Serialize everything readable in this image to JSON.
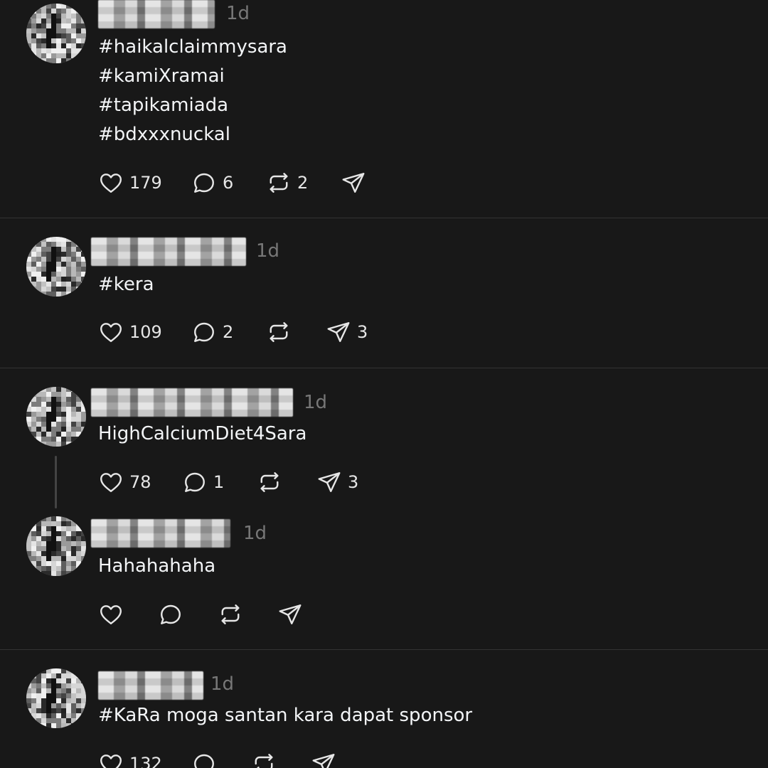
{
  "posts": [
    {
      "timestamp": "1d",
      "text": "#haikalclaimmysara\n#kamiXramai\n#tapikamiada\n#bdxxxnuckal",
      "likes": "179",
      "replies": "6",
      "reposts": "2",
      "shares": ""
    },
    {
      "timestamp": "1d",
      "text": "#kera",
      "likes": "109",
      "replies": "2",
      "reposts": "",
      "shares": "3"
    },
    {
      "timestamp": "1d",
      "text": "HighCalciumDiet4Sara",
      "likes": "78",
      "replies": "1",
      "reposts": "",
      "shares": "3"
    },
    {
      "timestamp": "1d",
      "text": "Hahahahaha",
      "likes": "",
      "replies": "",
      "reposts": "",
      "shares": ""
    },
    {
      "timestamp": "1d",
      "text": "#KaRa moga santan kara dapat sponsor",
      "likes": "132",
      "replies": "",
      "reposts": "",
      "shares": ""
    }
  ],
  "icons": {
    "like": "heart-icon",
    "reply": "comment-icon",
    "repost": "repost-icon",
    "share": "send-icon"
  },
  "colors": {
    "background": "#181818",
    "text": "#f3f5f7",
    "muted": "#777777",
    "divider": "#333333"
  }
}
